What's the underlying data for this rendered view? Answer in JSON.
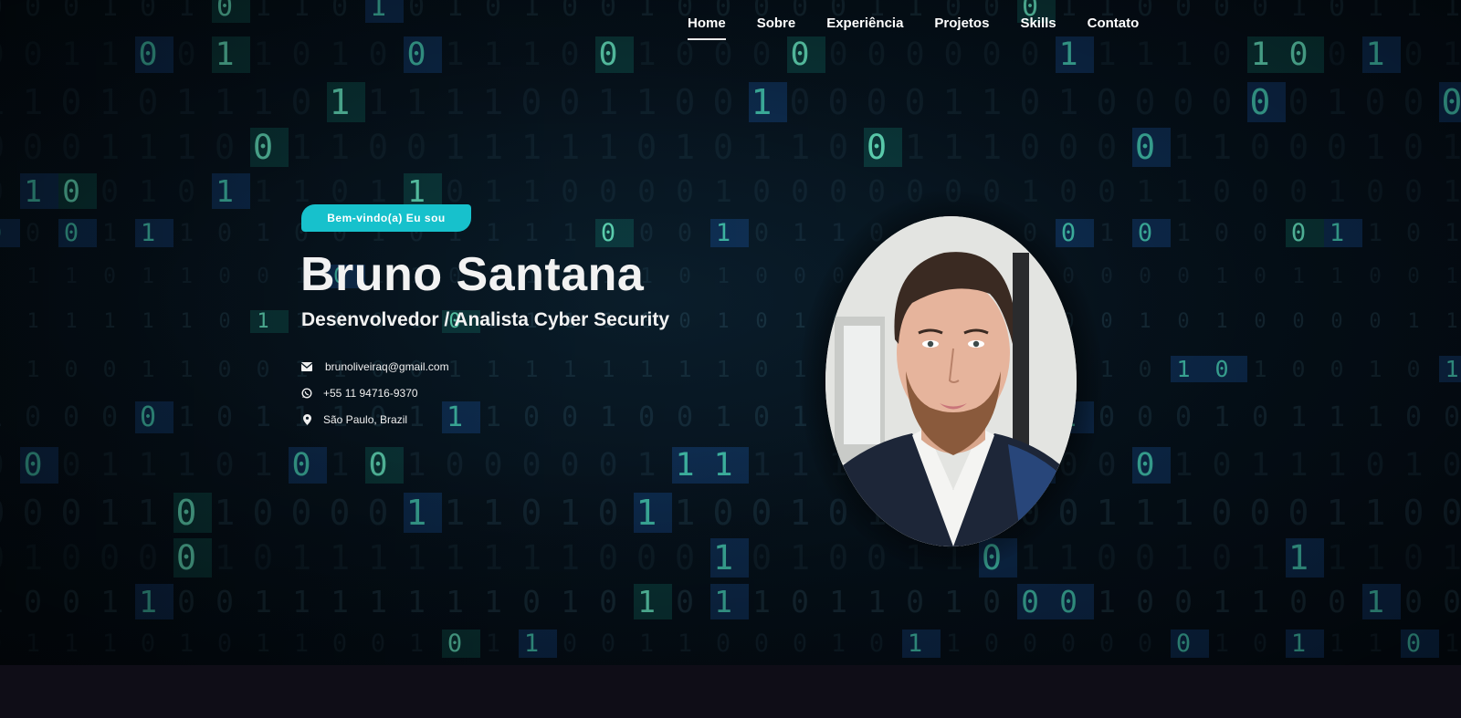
{
  "nav": {
    "items": [
      {
        "label": "Home",
        "active": true
      },
      {
        "label": "Sobre",
        "active": false
      },
      {
        "label": "Experiência",
        "active": false
      },
      {
        "label": "Projetos",
        "active": false
      },
      {
        "label": "Skills",
        "active": false
      },
      {
        "label": "Contato",
        "active": false
      }
    ]
  },
  "hero": {
    "badge": "Bem-vindo(a) Eu sou",
    "name": "Bruno Santana",
    "role": "Desenvolvedor / Analista Cyber Security",
    "contacts": {
      "email": {
        "icon": "envelope-icon",
        "text": "brunoliveiraq@gmail.com"
      },
      "phone": {
        "icon": "whatsapp-icon",
        "text": "+55 11 94716-9370"
      },
      "location": {
        "icon": "map-pin-icon",
        "text": "São Paulo, Brazil"
      }
    },
    "photo": {
      "alt": "profile-photo"
    }
  },
  "colors": {
    "accent": "#17c1cc",
    "hero_bg": "#06121c",
    "footer_bg": "#0f0d17",
    "text": "#ffffff"
  }
}
